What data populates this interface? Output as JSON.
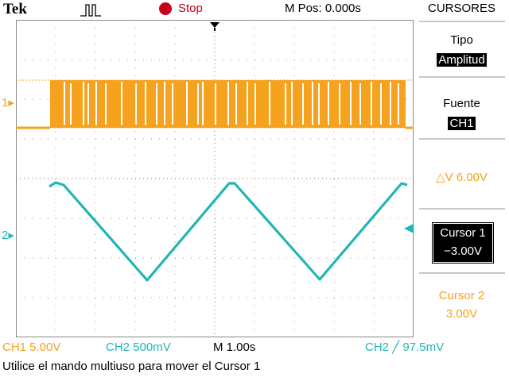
{
  "status": {
    "brand": "Tek",
    "trigger_icon": "pulse-trigger-icon",
    "run_state": "Stop",
    "run_state_color": "#c8001c",
    "m_pos": "M Pos: 0.000s"
  },
  "channels": {
    "ch1": {
      "marker": "1",
      "color": "#f5a21e"
    },
    "ch2": {
      "marker": "2",
      "color": "#22b5b5"
    }
  },
  "menu": {
    "title": "CURSORES",
    "tipo": {
      "label": "Tipo",
      "value": "Amplitud"
    },
    "fuente": {
      "label": "Fuente",
      "value": "CH1"
    },
    "delta": {
      "value": "△V 6.00V"
    },
    "cursor1": {
      "label": "Cursor 1",
      "value": "−3.00V"
    },
    "cursor2": {
      "label": "Cursor 2",
      "value": "3.00V"
    }
  },
  "bottom": {
    "ch1_scale": "CH1  5.00V",
    "ch2_scale": "CH2  500mV",
    "timebase": "M 1.00s",
    "trigger": "CH2 ╱ 97.5mV",
    "message": "Utilice el mando multiuso para mover el Cursor 1"
  }
}
